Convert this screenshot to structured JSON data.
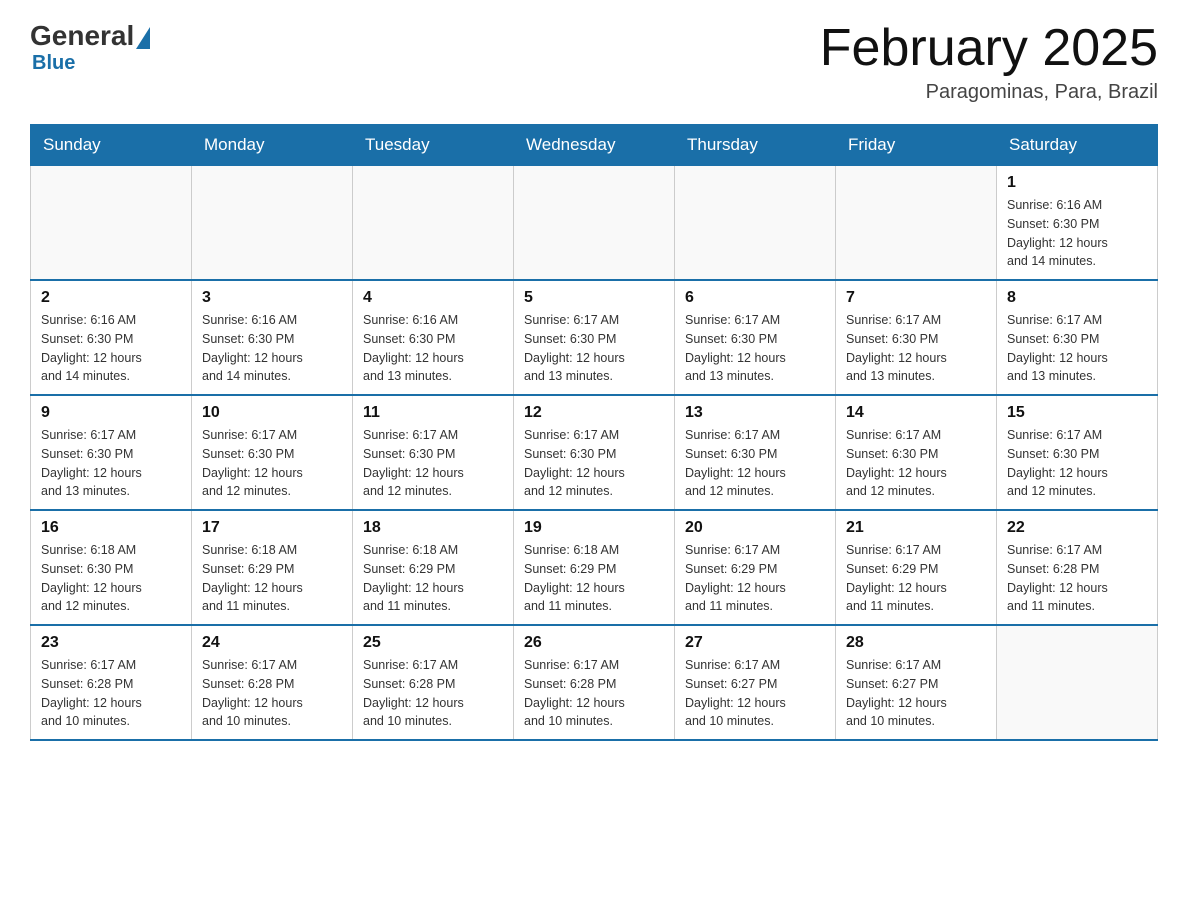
{
  "logo": {
    "general": "General",
    "blue": "Blue"
  },
  "header": {
    "title": "February 2025",
    "subtitle": "Paragominas, Para, Brazil"
  },
  "days_of_week": [
    "Sunday",
    "Monday",
    "Tuesday",
    "Wednesday",
    "Thursday",
    "Friday",
    "Saturday"
  ],
  "weeks": [
    [
      {
        "day": "",
        "info": ""
      },
      {
        "day": "",
        "info": ""
      },
      {
        "day": "",
        "info": ""
      },
      {
        "day": "",
        "info": ""
      },
      {
        "day": "",
        "info": ""
      },
      {
        "day": "",
        "info": ""
      },
      {
        "day": "1",
        "info": "Sunrise: 6:16 AM\nSunset: 6:30 PM\nDaylight: 12 hours\nand 14 minutes."
      }
    ],
    [
      {
        "day": "2",
        "info": "Sunrise: 6:16 AM\nSunset: 6:30 PM\nDaylight: 12 hours\nand 14 minutes."
      },
      {
        "day": "3",
        "info": "Sunrise: 6:16 AM\nSunset: 6:30 PM\nDaylight: 12 hours\nand 14 minutes."
      },
      {
        "day": "4",
        "info": "Sunrise: 6:16 AM\nSunset: 6:30 PM\nDaylight: 12 hours\nand 13 minutes."
      },
      {
        "day": "5",
        "info": "Sunrise: 6:17 AM\nSunset: 6:30 PM\nDaylight: 12 hours\nand 13 minutes."
      },
      {
        "day": "6",
        "info": "Sunrise: 6:17 AM\nSunset: 6:30 PM\nDaylight: 12 hours\nand 13 minutes."
      },
      {
        "day": "7",
        "info": "Sunrise: 6:17 AM\nSunset: 6:30 PM\nDaylight: 12 hours\nand 13 minutes."
      },
      {
        "day": "8",
        "info": "Sunrise: 6:17 AM\nSunset: 6:30 PM\nDaylight: 12 hours\nand 13 minutes."
      }
    ],
    [
      {
        "day": "9",
        "info": "Sunrise: 6:17 AM\nSunset: 6:30 PM\nDaylight: 12 hours\nand 13 minutes."
      },
      {
        "day": "10",
        "info": "Sunrise: 6:17 AM\nSunset: 6:30 PM\nDaylight: 12 hours\nand 12 minutes."
      },
      {
        "day": "11",
        "info": "Sunrise: 6:17 AM\nSunset: 6:30 PM\nDaylight: 12 hours\nand 12 minutes."
      },
      {
        "day": "12",
        "info": "Sunrise: 6:17 AM\nSunset: 6:30 PM\nDaylight: 12 hours\nand 12 minutes."
      },
      {
        "day": "13",
        "info": "Sunrise: 6:17 AM\nSunset: 6:30 PM\nDaylight: 12 hours\nand 12 minutes."
      },
      {
        "day": "14",
        "info": "Sunrise: 6:17 AM\nSunset: 6:30 PM\nDaylight: 12 hours\nand 12 minutes."
      },
      {
        "day": "15",
        "info": "Sunrise: 6:17 AM\nSunset: 6:30 PM\nDaylight: 12 hours\nand 12 minutes."
      }
    ],
    [
      {
        "day": "16",
        "info": "Sunrise: 6:18 AM\nSunset: 6:30 PM\nDaylight: 12 hours\nand 12 minutes."
      },
      {
        "day": "17",
        "info": "Sunrise: 6:18 AM\nSunset: 6:29 PM\nDaylight: 12 hours\nand 11 minutes."
      },
      {
        "day": "18",
        "info": "Sunrise: 6:18 AM\nSunset: 6:29 PM\nDaylight: 12 hours\nand 11 minutes."
      },
      {
        "day": "19",
        "info": "Sunrise: 6:18 AM\nSunset: 6:29 PM\nDaylight: 12 hours\nand 11 minutes."
      },
      {
        "day": "20",
        "info": "Sunrise: 6:17 AM\nSunset: 6:29 PM\nDaylight: 12 hours\nand 11 minutes."
      },
      {
        "day": "21",
        "info": "Sunrise: 6:17 AM\nSunset: 6:29 PM\nDaylight: 12 hours\nand 11 minutes."
      },
      {
        "day": "22",
        "info": "Sunrise: 6:17 AM\nSunset: 6:28 PM\nDaylight: 12 hours\nand 11 minutes."
      }
    ],
    [
      {
        "day": "23",
        "info": "Sunrise: 6:17 AM\nSunset: 6:28 PM\nDaylight: 12 hours\nand 10 minutes."
      },
      {
        "day": "24",
        "info": "Sunrise: 6:17 AM\nSunset: 6:28 PM\nDaylight: 12 hours\nand 10 minutes."
      },
      {
        "day": "25",
        "info": "Sunrise: 6:17 AM\nSunset: 6:28 PM\nDaylight: 12 hours\nand 10 minutes."
      },
      {
        "day": "26",
        "info": "Sunrise: 6:17 AM\nSunset: 6:28 PM\nDaylight: 12 hours\nand 10 minutes."
      },
      {
        "day": "27",
        "info": "Sunrise: 6:17 AM\nSunset: 6:27 PM\nDaylight: 12 hours\nand 10 minutes."
      },
      {
        "day": "28",
        "info": "Sunrise: 6:17 AM\nSunset: 6:27 PM\nDaylight: 12 hours\nand 10 minutes."
      },
      {
        "day": "",
        "info": ""
      }
    ]
  ]
}
